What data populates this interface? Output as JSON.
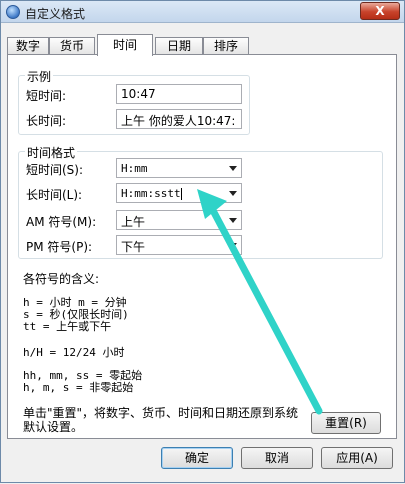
{
  "window": {
    "title": "自定义格式",
    "close_glyph": "X"
  },
  "tabs": [
    {
      "label": "数字",
      "active": false
    },
    {
      "label": "货币",
      "active": false
    },
    {
      "label": "时间",
      "active": true
    },
    {
      "label": "日期",
      "active": false
    },
    {
      "label": "排序",
      "active": false
    }
  ],
  "example": {
    "group_title": "示例",
    "short_label": "短时间:",
    "short_value": "10:47",
    "long_label": "长时间:",
    "long_value": "上午  你的爱人10:47:"
  },
  "format": {
    "group_title": "时间格式",
    "short_label": "短时间(S):",
    "short_value": "H:mm",
    "long_label": "长时间(L):",
    "long_value": "H:mm:sstt",
    "am_label": "AM 符号(M):",
    "am_value": "上午",
    "pm_label": "PM 符号(P):",
    "pm_value": "下午"
  },
  "legend": {
    "title": "各符号的含义:",
    "lines": [
      "h = 小时   m = 分钟",
      "s = 秒(仅限长时间)",
      "tt = 上午或下午",
      "h/H = 12/24 小时",
      "hh, mm, ss = 零起始",
      "h, m, s = 非零起始"
    ]
  },
  "reset": {
    "text": "单击\"重置\"，将数字、货币、时间和日期还原到系统默认设置。",
    "button": "重置(R)"
  },
  "buttons": {
    "ok": "确定",
    "cancel": "取消",
    "apply": "应用(A)"
  },
  "colors": {
    "annotation_arrow": "#2fd3c8"
  }
}
